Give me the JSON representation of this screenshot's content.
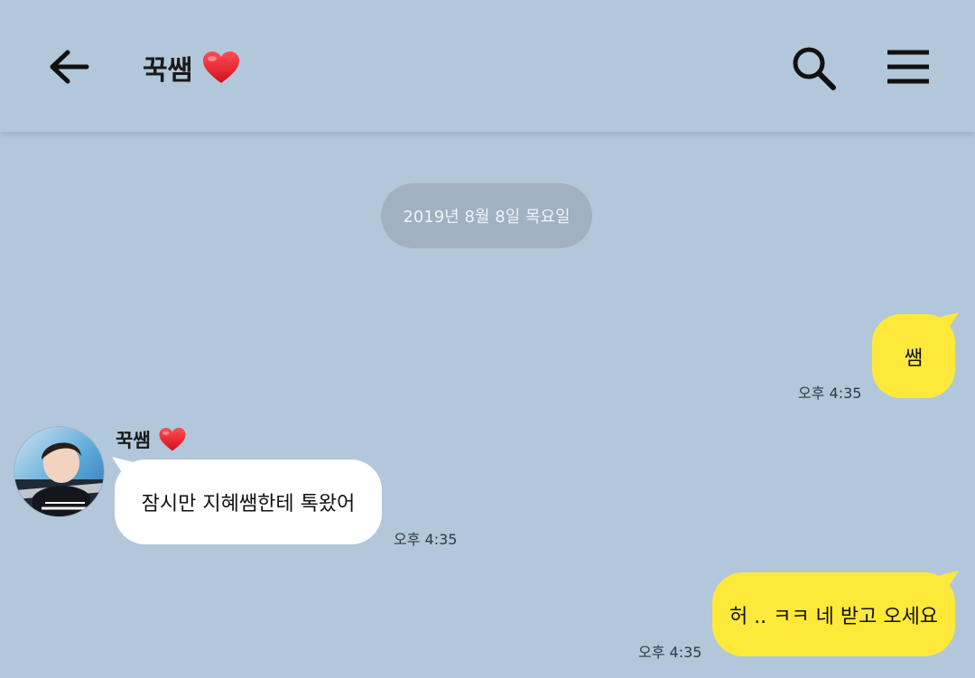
{
  "header": {
    "title": "꾹쌤",
    "back_icon": "arrow-left-icon",
    "heart_icon": "red-heart-icon",
    "search_icon": "search-icon",
    "menu_icon": "hamburger-menu-icon"
  },
  "date_divider": "2019년 8월 8일 목요일",
  "messages": [
    {
      "from": "me",
      "text": "쌤",
      "time": "오후 4:35"
    },
    {
      "from": "other",
      "sender": "꾹쌤",
      "text": "잠시만 지혜쌤한테 톡왔어",
      "time": "오후 4:35"
    },
    {
      "from": "me",
      "text": "허 .. ㅋㅋ 네 받고 오세요",
      "time": "오후 4:35"
    }
  ],
  "colors": {
    "background": "#b2c7da",
    "my_bubble": "#fee93a",
    "other_bubble": "#ffffff",
    "date_pill": "#a1b1c1",
    "heart": "#e8202a"
  }
}
